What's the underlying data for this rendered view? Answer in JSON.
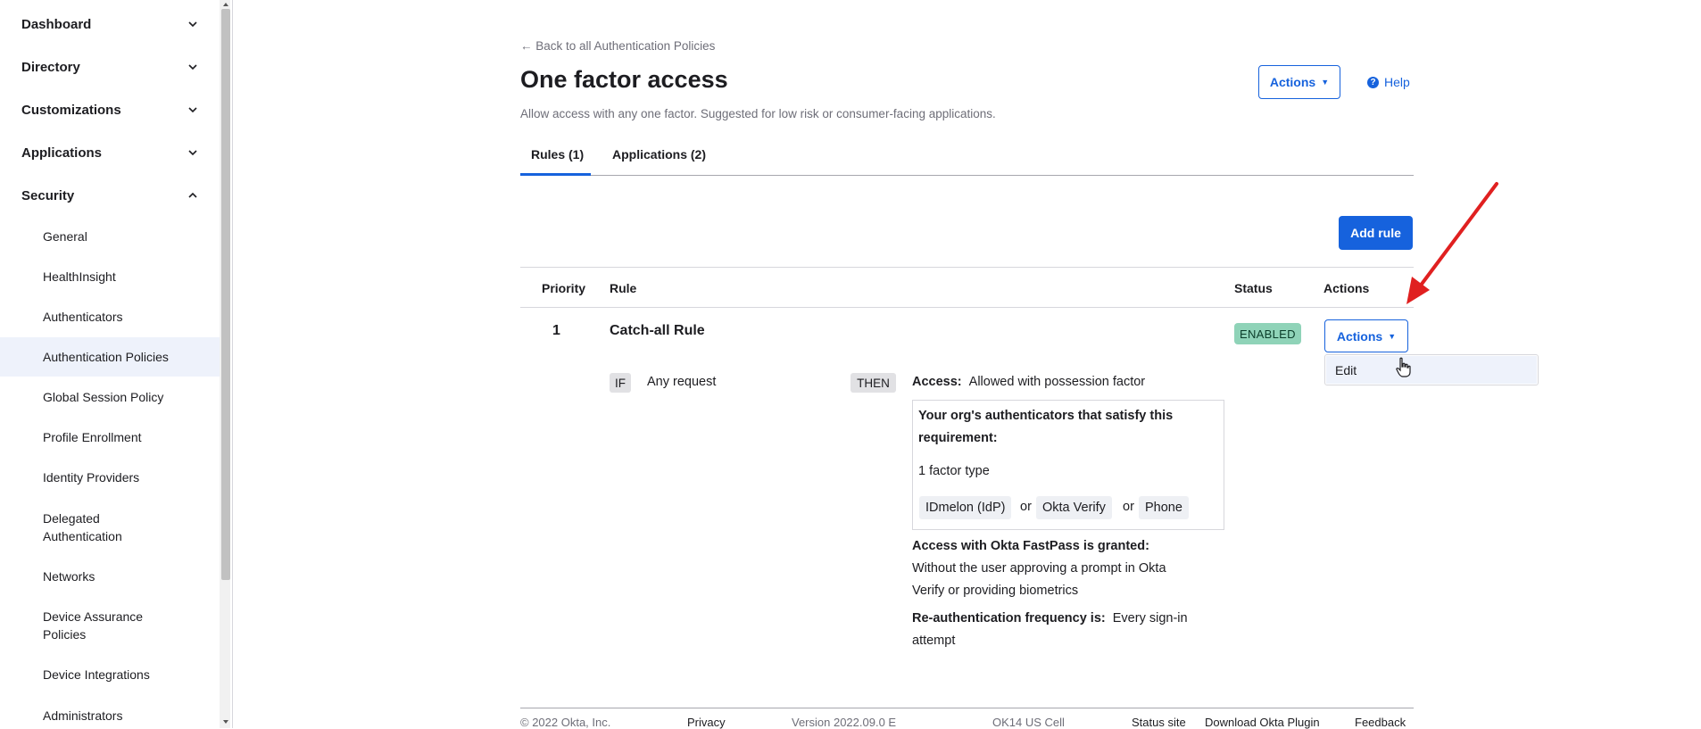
{
  "sidebar": {
    "sections": [
      {
        "label": "Dashboard",
        "expanded": false
      },
      {
        "label": "Directory",
        "expanded": false
      },
      {
        "label": "Customizations",
        "expanded": false
      },
      {
        "label": "Applications",
        "expanded": false
      },
      {
        "label": "Security",
        "expanded": true
      }
    ],
    "security_items": [
      "General",
      "HealthInsight",
      "Authenticators",
      "Authentication Policies",
      "Global Session Policy",
      "Profile Enrollment",
      "Identity Providers",
      "Delegated Authentication",
      "Networks",
      "Device Assurance Policies",
      "Device Integrations",
      "Administrators"
    ],
    "active_item": "Authentication Policies"
  },
  "page": {
    "back_link": "← Back to all Authentication Policies",
    "title": "One factor access",
    "subtitle": "Allow access with any one factor. Suggested for low risk or consumer-facing applications.",
    "actions_label": "Actions",
    "help_label": "Help",
    "tabs": [
      {
        "label": "Rules (1)",
        "active": true
      },
      {
        "label": "Applications (2)",
        "active": false
      }
    ],
    "add_rule_label": "Add rule"
  },
  "table": {
    "headers": [
      "Priority",
      "Rule",
      "Status",
      "Actions"
    ],
    "row": {
      "priority": "1",
      "rule_name": "Catch-all Rule",
      "status": "ENABLED",
      "actions_label": "Actions",
      "if_label": "IF",
      "condition": "Any request",
      "then_label": "THEN",
      "access_label": "Access:",
      "access_value": "Allowed with possession factor",
      "auth_box_title_line1": "Your org's authenticators that satisfy this",
      "auth_box_title_line2": "requirement:",
      "factor_type": "1 factor type",
      "authenticators": [
        "IDmelon (IdP)",
        "Okta Verify",
        "Phone"
      ],
      "or_label": "or",
      "fastpass_title": "Access with Okta FastPass is granted:",
      "fastpass_line1": "Without the user approving a prompt in Okta",
      "fastpass_line2": "Verify or providing biometrics",
      "reauth_label": "Re-authentication frequency is:",
      "reauth_value_line1": "Every sign-in",
      "reauth_value_line2": "attempt"
    }
  },
  "dropdown": {
    "items": [
      "Edit"
    ]
  },
  "footer": {
    "copyright": "© 2022 Okta, Inc.",
    "privacy": "Privacy",
    "version": "Version 2022.09.0 E",
    "cell": "OK14 US Cell",
    "status_site": "Status site",
    "download_plugin": "Download Okta Plugin",
    "feedback": "Feedback"
  },
  "colors": {
    "accent": "#1662dd",
    "enabled_badge": "#8fd3b8",
    "annotation_arrow": "#e02020"
  }
}
